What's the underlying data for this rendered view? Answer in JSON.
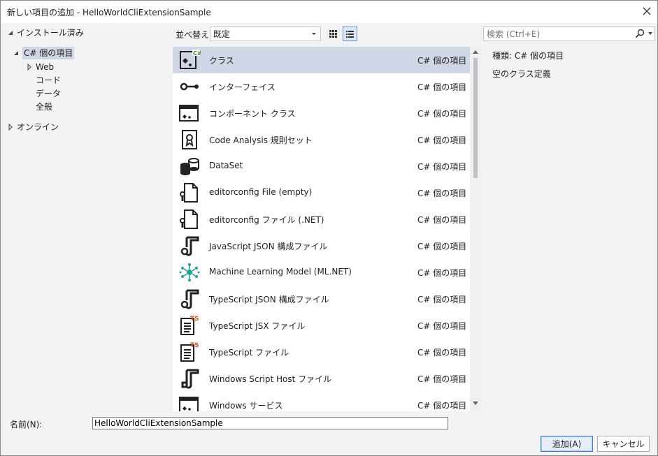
{
  "window": {
    "title": "新しい項目の追加 - HelloWorldCliExtensionSample"
  },
  "tree": {
    "installed": "インストール済み",
    "csharp_items": "C# 個の項目",
    "web": "Web",
    "code": "コード",
    "data": "データ",
    "general": "全般",
    "online": "オンライン"
  },
  "toolbar": {
    "sort_label": "並べ替え:",
    "sort_value": "既定",
    "search_placeholder": "検索 (Ctrl+E)"
  },
  "items": [
    {
      "name": "クラス",
      "type": "C# 個の項目",
      "icon": "class-icon"
    },
    {
      "name": "インターフェイス",
      "type": "C# 個の項目",
      "icon": "interface-icon"
    },
    {
      "name": "コンポーネント クラス",
      "type": "C# 個の項目",
      "icon": "component-class-icon"
    },
    {
      "name": "Code Analysis 規則セット",
      "type": "C# 個の項目",
      "icon": "ruleset-icon"
    },
    {
      "name": "DataSet",
      "type": "C# 個の項目",
      "icon": "dataset-icon"
    },
    {
      "name": "editorconfig File (empty)",
      "type": "C# 個の項目",
      "icon": "editorconfig-icon"
    },
    {
      "name": "editorconfig ファイル (.NET)",
      "type": "C# 個の項目",
      "icon": "editorconfig-icon"
    },
    {
      "name": "JavaScript JSON 構成ファイル",
      "type": "C# 個の項目",
      "icon": "json-config-icon"
    },
    {
      "name": "Machine Learning Model (ML.NET)",
      "type": "C# 個の項目",
      "icon": "ml-model-icon"
    },
    {
      "name": "TypeScript JSON 構成ファイル",
      "type": "C# 個の項目",
      "icon": "json-config-icon"
    },
    {
      "name": "TypeScript JSX ファイル",
      "type": "C# 個の項目",
      "icon": "typescript-file-icon"
    },
    {
      "name": "TypeScript ファイル",
      "type": "C# 個の項目",
      "icon": "typescript-file-icon"
    },
    {
      "name": "Windows Script Host ファイル",
      "type": "C# 個の項目",
      "icon": "script-host-icon"
    },
    {
      "name": "Windows サービス",
      "type": "C# 個の項目",
      "icon": "windows-service-icon"
    }
  ],
  "details": {
    "type_label": "種類:",
    "type_value": "C# 個の項目",
    "description": "空のクラス定義"
  },
  "footer": {
    "name_label": "名前(N):",
    "name_value": "HelloWorldCliExtensionSample",
    "add_button": "追加(A)",
    "cancel_button": "キャンセル"
  }
}
